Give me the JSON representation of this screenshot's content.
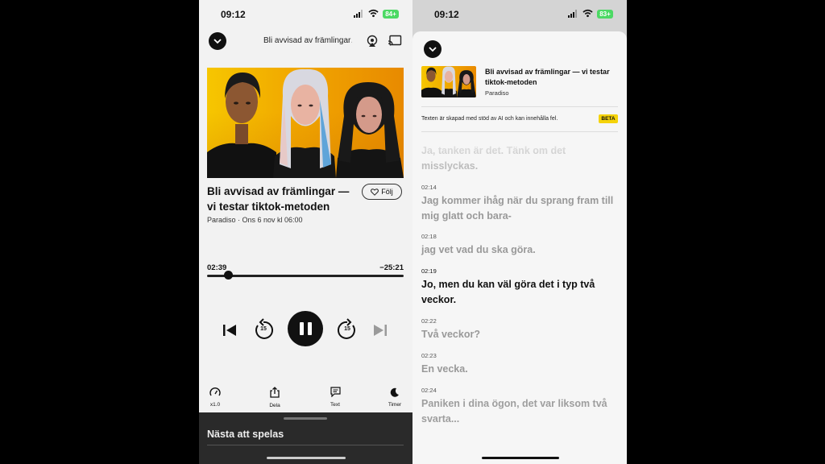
{
  "status": {
    "time": "09:12",
    "battery_left": "84+",
    "battery_right": "83+"
  },
  "player": {
    "header_title": "Bli avvisad av främlingar…",
    "episode_title": "Bli avvisad av främlingar — vi testar tiktok-metoden",
    "follow_label": "Följ",
    "meta": "Paradiso · Ons 6 nov kl 06:00",
    "elapsed": "02:39",
    "remaining": "−25:21",
    "progress": 0.11,
    "skip_back_seconds": "15",
    "skip_forward_seconds": "15",
    "state": "playing"
  },
  "toolbar": {
    "speed_label": "x1.0",
    "share_label": "Dela",
    "text_label": "Text",
    "timer_label": "Timer"
  },
  "next_up": {
    "label": "Nästa att spelas"
  },
  "transcript": {
    "title": "Bli avvisad av främlingar — vi testar tiktok-metoden",
    "podcast": "Paradiso",
    "ai_note": "Texten är skapad med stöd av AI och kan innehålla fel.",
    "beta_label": "BETA",
    "segments": [
      {
        "time": "",
        "text": "Ja, tanken är det. Tänk om det misslyckas."
      },
      {
        "time": "02:14",
        "text": "Jag kommer ihåg när du sprang fram till mig glatt och bara-"
      },
      {
        "time": "02:18",
        "text": "jag vet vad du ska göra."
      },
      {
        "time": "02:19",
        "text": "Jo, men du kan väl göra det i typ två veckor."
      },
      {
        "time": "02:22",
        "text": "Två veckor?"
      },
      {
        "time": "02:23",
        "text": "En vecka."
      },
      {
        "time": "02:24",
        "text": "Paniken i dina ögon, det var liksom två svarta..."
      }
    ]
  },
  "colors": {
    "accent_beta": "#f5d30a",
    "battery": "#4cd964",
    "dark": "#111111"
  }
}
